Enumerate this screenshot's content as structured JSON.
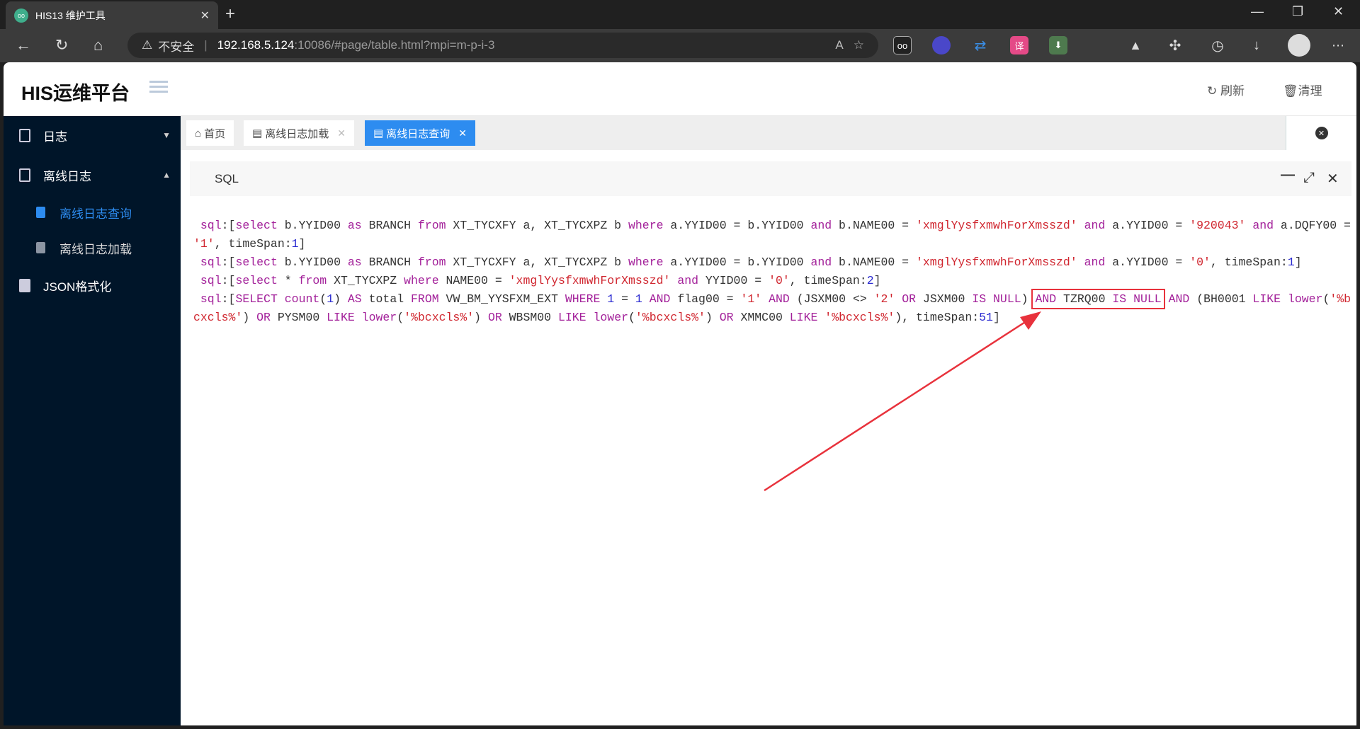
{
  "browser": {
    "tab_title": "HIS13 维护工具",
    "security_label": "不安全",
    "url_host": "192.168.5.124",
    "url_rest": ":10086/#page/table.html?mpi=m-p-i-3"
  },
  "header": {
    "logo": "HIS运维平台",
    "refresh_label": "刷新",
    "clear_label": "清理"
  },
  "sidebar": {
    "items": [
      {
        "label": "日志"
      },
      {
        "label": "离线日志"
      },
      {
        "label": "离线日志查询"
      },
      {
        "label": "离线日志加载"
      },
      {
        "label": "JSON格式化"
      }
    ]
  },
  "tabs": [
    {
      "label": "首页"
    },
    {
      "label": "离线日志加载"
    },
    {
      "label": "离线日志查询"
    }
  ],
  "panel": {
    "title": "SQL",
    "highlight_color": "#e8323c",
    "lines": [
      [
        [
          "k",
          "sql"
        ],
        [
          "p",
          ":["
        ],
        [
          "k",
          "select"
        ],
        [
          "p",
          " b.YYID00 "
        ],
        [
          "k",
          "as"
        ],
        [
          "p",
          " BRANCH "
        ],
        [
          "k",
          "from"
        ],
        [
          "p",
          " XT_TYCXFY a, XT_TYCXPZ b "
        ],
        [
          "k",
          "where"
        ],
        [
          "p",
          " a.YYID00 = b.YYID00 "
        ],
        [
          "k",
          "and"
        ],
        [
          "p",
          " b.NAME00 = "
        ],
        [
          "s",
          "'xmglYysfxmwhForXmsszd'"
        ],
        [
          "p",
          " "
        ],
        [
          "k",
          "and"
        ],
        [
          "p",
          " a.YYID00 = "
        ],
        [
          "s",
          "'920043'"
        ],
        [
          "p",
          " "
        ],
        [
          "k",
          "and"
        ],
        [
          "p",
          " a.DQFY00 = "
        ],
        [
          "s",
          "'1'"
        ],
        [
          "p",
          ", timeSpan:"
        ],
        [
          "n",
          "1"
        ],
        [
          "p",
          "]"
        ]
      ],
      [
        [
          "k",
          "sql"
        ],
        [
          "p",
          ":["
        ],
        [
          "k",
          "select"
        ],
        [
          "p",
          " b.YYID00 "
        ],
        [
          "k",
          "as"
        ],
        [
          "p",
          " BRANCH "
        ],
        [
          "k",
          "from"
        ],
        [
          "p",
          " XT_TYCXFY a, XT_TYCXPZ b "
        ],
        [
          "k",
          "where"
        ],
        [
          "p",
          " a.YYID00 = b.YYID00 "
        ],
        [
          "k",
          "and"
        ],
        [
          "p",
          " b.NAME00 = "
        ],
        [
          "s",
          "'xmglYysfxmwhForXmsszd'"
        ],
        [
          "p",
          " "
        ],
        [
          "k",
          "and"
        ],
        [
          "p",
          " a.YYID00 = "
        ],
        [
          "s",
          "'0'"
        ],
        [
          "p",
          ", timeSpan:"
        ],
        [
          "n",
          "1"
        ],
        [
          "p",
          "]"
        ]
      ],
      [
        [
          "k",
          "sql"
        ],
        [
          "p",
          ":["
        ],
        [
          "k",
          "select"
        ],
        [
          "p",
          " * "
        ],
        [
          "k",
          "from"
        ],
        [
          "p",
          " XT_TYCXPZ "
        ],
        [
          "k",
          "where"
        ],
        [
          "p",
          " NAME00 = "
        ],
        [
          "s",
          "'xmglYysfxmwhForXmsszd'"
        ],
        [
          "p",
          " "
        ],
        [
          "k",
          "and"
        ],
        [
          "p",
          " YYID00 = "
        ],
        [
          "s",
          "'0'"
        ],
        [
          "p",
          ", timeSpan:"
        ],
        [
          "n",
          "2"
        ],
        [
          "p",
          "]"
        ]
      ],
      [
        [
          "k",
          "sql"
        ],
        [
          "p",
          ":["
        ],
        [
          "k",
          "SELECT"
        ],
        [
          "p",
          " "
        ],
        [
          "k",
          "count"
        ],
        [
          "p",
          "("
        ],
        [
          "n",
          "1"
        ],
        [
          "p",
          ") "
        ],
        [
          "k",
          "AS"
        ],
        [
          "p",
          " total "
        ],
        [
          "k",
          "FROM"
        ],
        [
          "p",
          " VW_BM_YYSFXM_EXT "
        ],
        [
          "k",
          "WHERE"
        ],
        [
          "p",
          " "
        ],
        [
          "n",
          "1"
        ],
        [
          "p",
          " = "
        ],
        [
          "n",
          "1"
        ],
        [
          "p",
          " "
        ],
        [
          "k",
          "AND"
        ],
        [
          "p",
          " flag00 = "
        ],
        [
          "s",
          "'1'"
        ],
        [
          "p",
          " "
        ],
        [
          "k",
          "AND"
        ],
        [
          "p",
          " (JSXM00 <> "
        ],
        [
          "s",
          "'2'"
        ],
        [
          "p",
          " "
        ],
        [
          "k",
          "OR"
        ],
        [
          "p",
          " JSXM00 "
        ],
        [
          "k",
          "IS NULL"
        ],
        [
          "p",
          ") "
        ],
        [
          "hk",
          "AND"
        ],
        [
          "hp",
          " TZRQ00 "
        ],
        [
          "hk",
          "IS NULL"
        ],
        [
          "p",
          " "
        ],
        [
          "k",
          "AND"
        ],
        [
          "p",
          " (BH0001 "
        ],
        [
          "k",
          "LIKE"
        ],
        [
          "p",
          " "
        ],
        [
          "k",
          "lower"
        ],
        [
          "p",
          "("
        ],
        [
          "s",
          "'%bcxcls%'"
        ],
        [
          "p",
          ") "
        ],
        [
          "k",
          "OR"
        ],
        [
          "p",
          " PYSM00 "
        ],
        [
          "k",
          "LIKE"
        ],
        [
          "p",
          " "
        ],
        [
          "k",
          "lower"
        ],
        [
          "p",
          "("
        ],
        [
          "s",
          "'%bcxcls%'"
        ],
        [
          "p",
          ") "
        ],
        [
          "k",
          "OR"
        ],
        [
          "p",
          " WBSM00 "
        ],
        [
          "k",
          "LIKE"
        ],
        [
          "p",
          " "
        ],
        [
          "k",
          "lower"
        ],
        [
          "p",
          "("
        ],
        [
          "s",
          "'%bcxcls%'"
        ],
        [
          "p",
          ") "
        ],
        [
          "k",
          "OR"
        ],
        [
          "p",
          " XMMC00 "
        ],
        [
          "k",
          "LIKE"
        ],
        [
          "p",
          " "
        ],
        [
          "s",
          "'%bcxcls%'"
        ],
        [
          "p",
          "), timeSpan:"
        ],
        [
          "n",
          "51"
        ],
        [
          "p",
          "]"
        ]
      ]
    ]
  }
}
